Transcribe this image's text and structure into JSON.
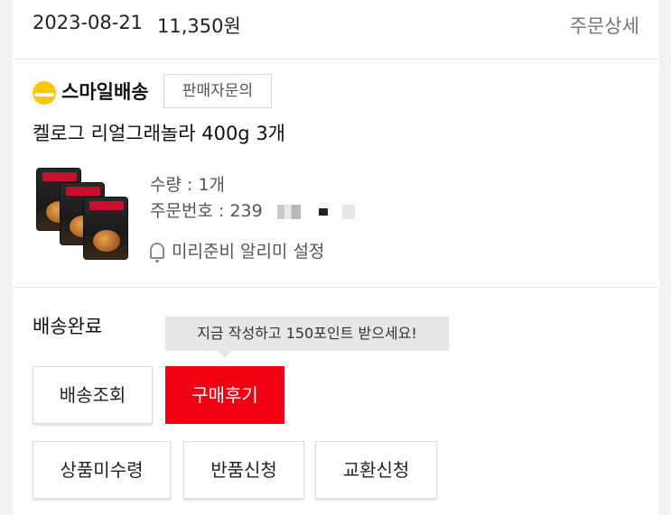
{
  "order": {
    "date": "2023-08-21",
    "price": "11,350원",
    "detail_label": "주문상세"
  },
  "seller": {
    "smile_label": "스마일배송",
    "inquiry_label": "판매자문의"
  },
  "product": {
    "name": "켈로그 리얼그래놀라 400g 3개",
    "quantity": "수량 : 1개",
    "order_number": "주문번호 : 239",
    "alarm": "미리준비 알리미 설정"
  },
  "status": "배송완료",
  "tooltip": "지금 작성하고 150포인트 받으세요!",
  "buttons": {
    "track": "배송조회",
    "review": "구매후기",
    "not_received": "상품미수령",
    "return": "반품신청",
    "exchange": "교환신청"
  },
  "colors": {
    "accent_red": "#f20012",
    "smile_yellow": "#ffc800"
  }
}
